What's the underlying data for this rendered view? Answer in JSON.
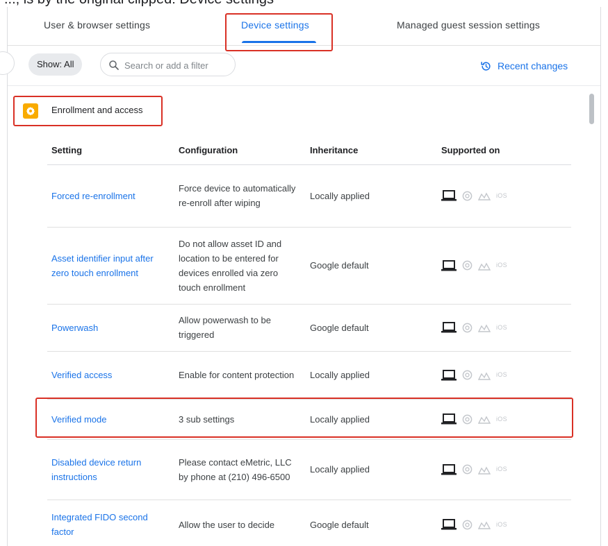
{
  "top_fragment": "..., is by the original clipped: Device settings",
  "tabs": [
    {
      "label": "User & browser settings",
      "active": false
    },
    {
      "label": "Device settings",
      "active": true
    },
    {
      "label": "Managed guest session settings",
      "active": false
    }
  ],
  "toolbar": {
    "show_label": "Show: All",
    "search_placeholder": "Search or add a filter",
    "recent_changes_label": "Recent changes"
  },
  "section": {
    "title": "Enrollment and access",
    "icon": "gear-icon"
  },
  "table": {
    "headers": [
      "Setting",
      "Configuration",
      "Inheritance",
      "Supported on"
    ],
    "rows": [
      {
        "setting": "Forced re-enrollment",
        "configuration": "Force device to automatically re-enroll after wiping",
        "inheritance": "Locally applied",
        "supported_on": [
          "laptop-icon",
          "chrome-icon",
          "kiosk-icon",
          "iOS"
        ]
      },
      {
        "setting": "Asset identifier input after zero touch enrollment",
        "configuration": "Do not allow asset ID and location to be entered for devices enrolled via zero touch enrollment",
        "inheritance": "Google default",
        "supported_on": [
          "laptop-icon",
          "chrome-icon",
          "kiosk-icon",
          "iOS"
        ]
      },
      {
        "setting": "Powerwash",
        "configuration": "Allow powerwash to be triggered",
        "inheritance": "Google default",
        "supported_on": [
          "laptop-icon",
          "chrome-icon",
          "kiosk-icon",
          "iOS"
        ]
      },
      {
        "setting": "Verified access",
        "configuration": "Enable for content protection",
        "inheritance": "Locally applied",
        "supported_on": [
          "laptop-icon",
          "chrome-icon",
          "kiosk-icon",
          "iOS"
        ]
      },
      {
        "setting": "Verified mode",
        "configuration": "3 sub settings",
        "inheritance": "Locally applied",
        "supported_on": [
          "laptop-icon",
          "chrome-icon",
          "kiosk-icon",
          "iOS"
        ]
      },
      {
        "setting": "Disabled device return instructions",
        "configuration": "Please contact eMetric, LLC by phone at (210) 496-6500",
        "inheritance": "Locally applied",
        "supported_on": [
          "laptop-icon",
          "chrome-icon",
          "kiosk-icon",
          "iOS"
        ]
      },
      {
        "setting": "Integrated FIDO second factor",
        "configuration": "Allow the user to decide",
        "inheritance": "Google default",
        "supported_on": [
          "laptop-icon",
          "chrome-icon",
          "kiosk-icon",
          "iOS"
        ]
      }
    ]
  },
  "colors": {
    "accent": "#1a73e8",
    "highlight": "#d93025",
    "section_icon": "#f9ab00"
  }
}
